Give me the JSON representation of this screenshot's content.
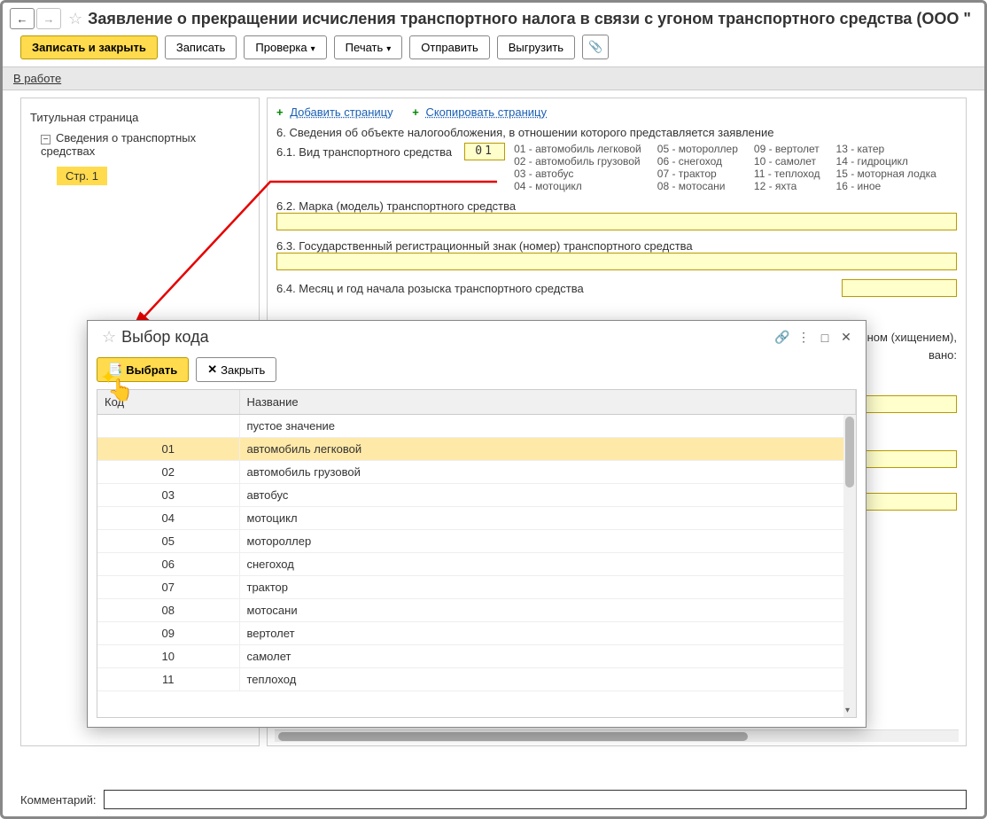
{
  "title": "Заявление о прекращении исчисления транспортного налога в связи с угоном транспортного средства (ООО \"",
  "toolbar": {
    "save_close": "Записать и закрыть",
    "save": "Записать",
    "check": "Проверка",
    "print": "Печать",
    "send": "Отправить",
    "upload": "Выгрузить"
  },
  "status": {
    "label": "В работе"
  },
  "sidebar": {
    "item_title": "Титульная страница",
    "item_vehicles": "Сведения о транспортных средствах",
    "page1": "Стр. 1"
  },
  "page_actions": {
    "add": "Добавить страницу",
    "copy": "Скопировать страницу"
  },
  "labels": {
    "sec6": "6. Сведения об объекте налогообложения, в отношении которого представляется заявление",
    "sec61": "6.1. Вид транспортного средства",
    "sec62": "6.2. Марка (модель) транспортного средства",
    "sec63": "6.3. Государственный регистрационный знак (номер) транспортного средства",
    "sec64": "6.4. Месяц и год начала розыска транспортного средства",
    "partial1": "гоном (хищением),",
    "partial2": "вано:"
  },
  "code_value": "01",
  "types": [
    "01 - автомобиль легковой",
    "05 - мотороллер",
    "09 - вертолет",
    "13 - катер",
    "02 - автомобиль грузовой",
    "06 - снегоход",
    "10 - самолет",
    "14 - гидроцикл",
    "03 - автобус",
    "07 - трактор",
    "11 - теплоход",
    "15 - моторная лодка",
    "04 - мотоцикл",
    "08 - мотосани",
    "12 - яхта",
    "16 - иное"
  ],
  "comment_label": "Комментарий:",
  "modal": {
    "title": "Выбор кода",
    "select": "Выбрать",
    "close": "Закрыть",
    "col_code": "Код",
    "col_name": "Название",
    "selected_index": 1,
    "rows": [
      {
        "code": "",
        "name": "пустое значение"
      },
      {
        "code": "01",
        "name": "автомобиль легковой"
      },
      {
        "code": "02",
        "name": "автомобиль грузовой"
      },
      {
        "code": "03",
        "name": "автобус"
      },
      {
        "code": "04",
        "name": "мотоцикл"
      },
      {
        "code": "05",
        "name": "мотороллер"
      },
      {
        "code": "06",
        "name": "снегоход"
      },
      {
        "code": "07",
        "name": "трактор"
      },
      {
        "code": "08",
        "name": "мотосани"
      },
      {
        "code": "09",
        "name": "вертолет"
      },
      {
        "code": "10",
        "name": "самолет"
      },
      {
        "code": "11",
        "name": "теплоход"
      }
    ]
  }
}
